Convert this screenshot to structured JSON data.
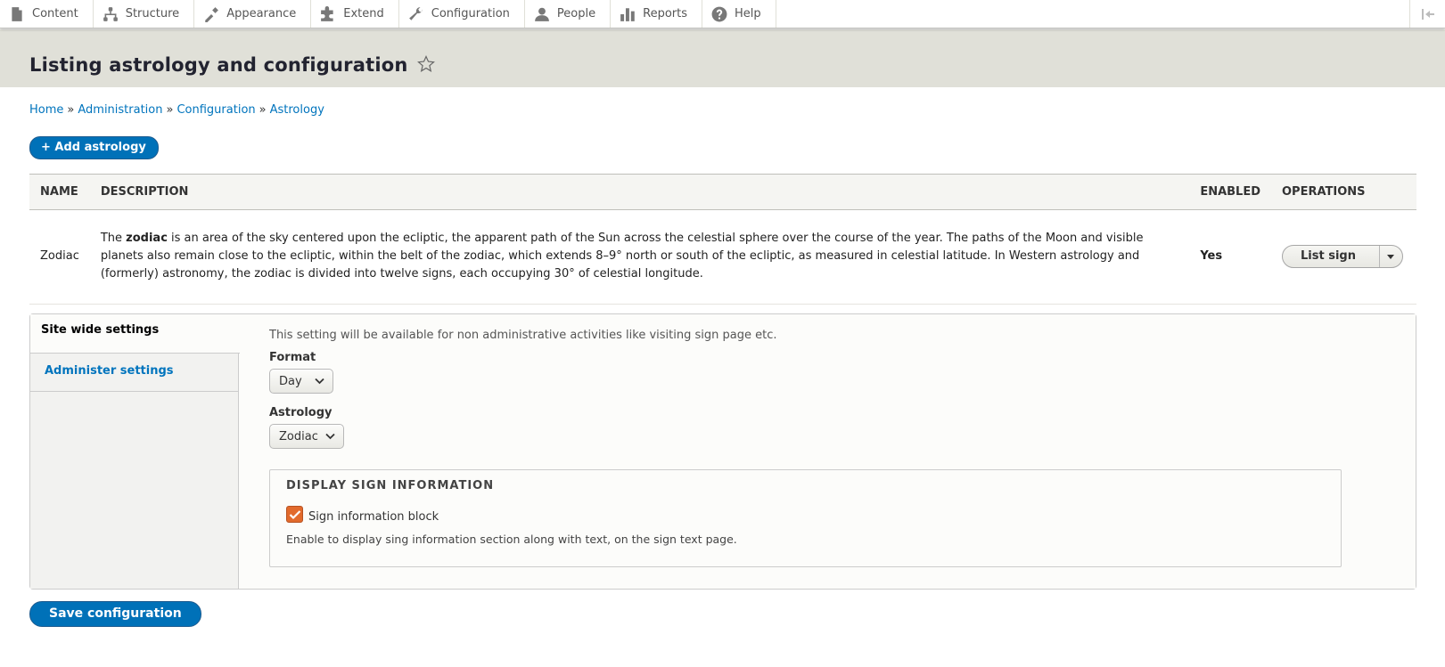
{
  "toolbar": {
    "items": [
      {
        "label": "Content",
        "icon": "content-icon"
      },
      {
        "label": "Structure",
        "icon": "structure-icon"
      },
      {
        "label": "Appearance",
        "icon": "appearance-icon"
      },
      {
        "label": "Extend",
        "icon": "extend-icon"
      },
      {
        "label": "Configuration",
        "icon": "configuration-icon"
      },
      {
        "label": "People",
        "icon": "people-icon"
      },
      {
        "label": "Reports",
        "icon": "reports-icon"
      },
      {
        "label": "Help",
        "icon": "help-icon"
      }
    ]
  },
  "page": {
    "title": "Listing astrology and configuration"
  },
  "breadcrumb": [
    "Home",
    "Administration",
    "Configuration",
    "Astrology"
  ],
  "breadcrumb_sep": "»",
  "add_button": "+ Add astrology",
  "table": {
    "headers": [
      "Name",
      "Description",
      "Enabled",
      "Operations"
    ],
    "row": {
      "name": "Zodiac",
      "desc_pre": "The ",
      "desc_bold": "zodiac",
      "desc_post": " is an area of the sky centered upon the ecliptic, the apparent path of the Sun across the celestial sphere over the course of the year. The paths of the Moon and visible planets also remain close to the ecliptic, within the belt of the zodiac, which extends 8–9° north or south of the ecliptic, as measured in celestial latitude. In Western astrology and (formerly) astronomy, the zodiac is divided into twelve signs, each occupying 30° of celestial longitude.",
      "enabled": "Yes",
      "operation": "List sign"
    }
  },
  "tabs": {
    "active": "Site wide settings",
    "other": "Administer settings"
  },
  "panel": {
    "description": "This setting will be available for non administrative activities like visiting sign page etc.",
    "format_label": "Format",
    "format_value": "Day",
    "astrology_label": "Astrology",
    "astrology_value": "Zodiac",
    "fieldset_legend": "Display sign information",
    "checkbox_label": "Sign information block",
    "checkbox_checked": true,
    "help": "Enable to display sing information section along with text, on the sign text page."
  },
  "save_button": "Save configuration",
  "colors": {
    "primary": "#0071b8",
    "link": "#0074bd",
    "checkbox": "#e26a2c",
    "header_bg": "#e0e0d8"
  }
}
